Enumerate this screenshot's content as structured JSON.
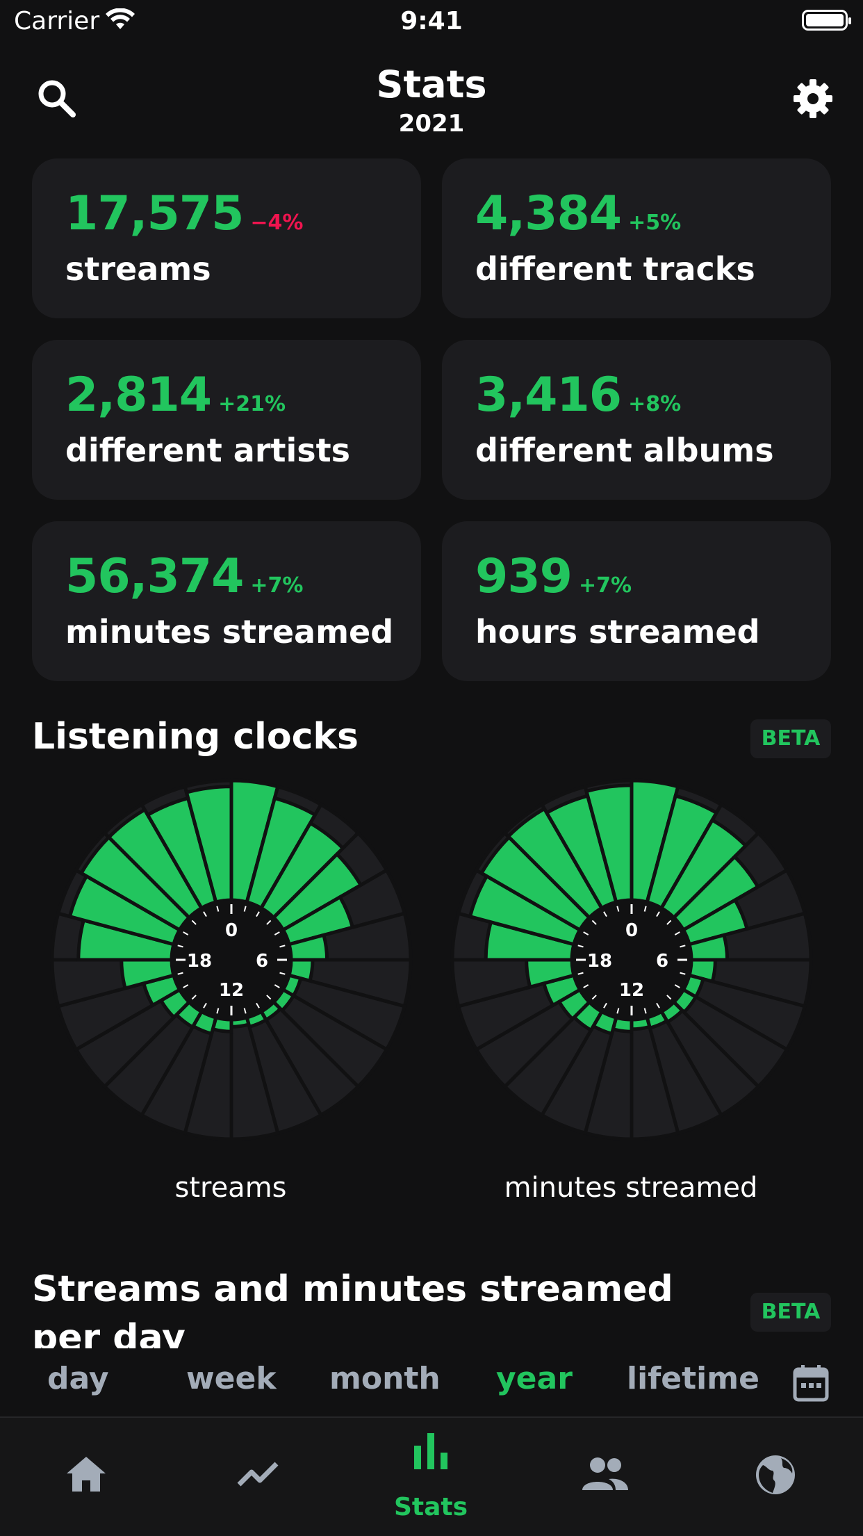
{
  "status_bar": {
    "carrier": "Carrier",
    "time": "9:41"
  },
  "header": {
    "title": "Stats",
    "subtitle": "2021"
  },
  "stats": [
    {
      "value": "17,575",
      "delta": "−4%",
      "label": "streams",
      "trend": "down"
    },
    {
      "value": "4,384",
      "delta": "+5%",
      "label": "different tracks",
      "trend": "up"
    },
    {
      "value": "2,814",
      "delta": "+21%",
      "label": "different artists",
      "trend": "up"
    },
    {
      "value": "3,416",
      "delta": "+8%",
      "label": "different albums",
      "trend": "up"
    },
    {
      "value": "56,374",
      "delta": "+7%",
      "label": "minutes streamed",
      "trend": "up"
    },
    {
      "value": "939",
      "delta": "+7%",
      "label": "hours streamed",
      "trend": "up"
    }
  ],
  "listening_clocks": {
    "title": "Listening clocks",
    "badge": "BETA",
    "dial_labels": [
      "0",
      "6",
      "12",
      "18"
    ],
    "clocks": [
      {
        "label": "streams",
        "hourly_fraction": [
          1.0,
          0.9,
          0.82,
          0.75,
          0.55,
          0.3,
          0.18,
          0.1,
          0.1,
          0.08,
          0.08,
          0.06,
          0.1,
          0.14,
          0.15,
          0.18,
          0.26,
          0.42,
          0.78,
          0.9,
          0.95,
          0.95,
          0.9,
          0.95
        ]
      },
      {
        "label": "minutes streamed",
        "hourly_fraction": [
          1.0,
          0.92,
          0.85,
          0.72,
          0.5,
          0.3,
          0.2,
          0.12,
          0.12,
          0.1,
          0.09,
          0.08,
          0.1,
          0.14,
          0.18,
          0.2,
          0.26,
          0.38,
          0.72,
          0.9,
          0.95,
          0.96,
          0.92,
          0.96
        ]
      }
    ]
  },
  "per_day": {
    "title": "Streams and minutes streamed per day",
    "badge": "BETA"
  },
  "period_selector": {
    "options": [
      "day",
      "week",
      "month",
      "year",
      "lifetime"
    ],
    "selected": "year"
  },
  "tab_bar": {
    "active_label": "Stats",
    "tabs": [
      "home-icon",
      "trending-icon",
      "stats-icon",
      "friends-icon",
      "globe-icon"
    ]
  },
  "colors": {
    "accent": "#22c55e",
    "negative": "#f0144f",
    "card": "#1c1c1f",
    "background": "#111112"
  }
}
